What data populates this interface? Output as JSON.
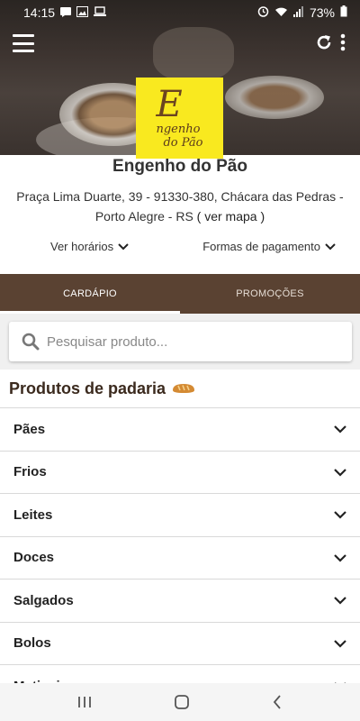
{
  "status_bar": {
    "time": "14:15",
    "battery": "73%"
  },
  "store": {
    "name": "Engenho do Pão",
    "logo_line1": "ngenho",
    "logo_line2": "do Pão",
    "logo_initial": "E",
    "address": "Praça Lima Duarte, 39 - 91330-380, Chácara das Pedras - Porto Alegre - RS",
    "map_link": "( ver mapa )"
  },
  "info_links": {
    "hours": "Ver horários",
    "payment": "Formas de pagamento"
  },
  "tabs": [
    {
      "label": "CARDÁPIO",
      "active": true
    },
    {
      "label": "PROMOÇÕES",
      "active": false
    }
  ],
  "search": {
    "placeholder": "Pesquisar produto..."
  },
  "section": {
    "title": "Produtos de padaria"
  },
  "categories": [
    {
      "label": "Pães"
    },
    {
      "label": "Frios"
    },
    {
      "label": "Leites"
    },
    {
      "label": "Doces"
    },
    {
      "label": "Salgados"
    },
    {
      "label": "Bolos"
    },
    {
      "label": "Matinais"
    }
  ],
  "colors": {
    "brand_brown": "#5a4232",
    "logo_yellow": "#f9e91f"
  }
}
